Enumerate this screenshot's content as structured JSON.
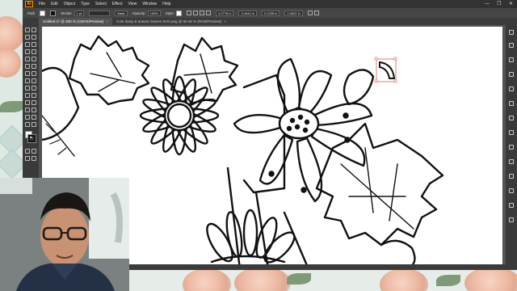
{
  "app": {
    "logo": "Ai",
    "menu": [
      "File",
      "Edit",
      "Object",
      "Type",
      "Select",
      "Effect",
      "View",
      "Window",
      "Help"
    ],
    "window_controls": [
      "—",
      "❐",
      "✕"
    ]
  },
  "control_bar": {
    "selection_label": "Path",
    "stroke_label": "Stroke:",
    "stroke_value": "1 pt",
    "brush_value": "Basic",
    "opacity_label": "Opacity:",
    "opacity_value": "100%",
    "style_label": "Style:",
    "x_value": "4.2778 in",
    "y_value": "3.4444 in",
    "w_value": "0.2235 in",
    "h_value": "0.2622 in"
  },
  "tabs": [
    {
      "label": "Untitled-1* @ 400 % (CMYK/Preview)",
      "active": true
    },
    {
      "label": "Cute daisy & autumn leaves SVG.png @ 50.46 % (RGB/Preview)",
      "active": false
    }
  ],
  "colors": {
    "accent": "#ff9a00",
    "panel_dark": "#323232",
    "panel_mid": "#464646",
    "canvas_bg": "#535353",
    "artboard": "#ffffff",
    "selection": "#e05a5a"
  },
  "icons": {
    "selection_handle": "bounding-box-icon",
    "tools": "tool-icon"
  }
}
